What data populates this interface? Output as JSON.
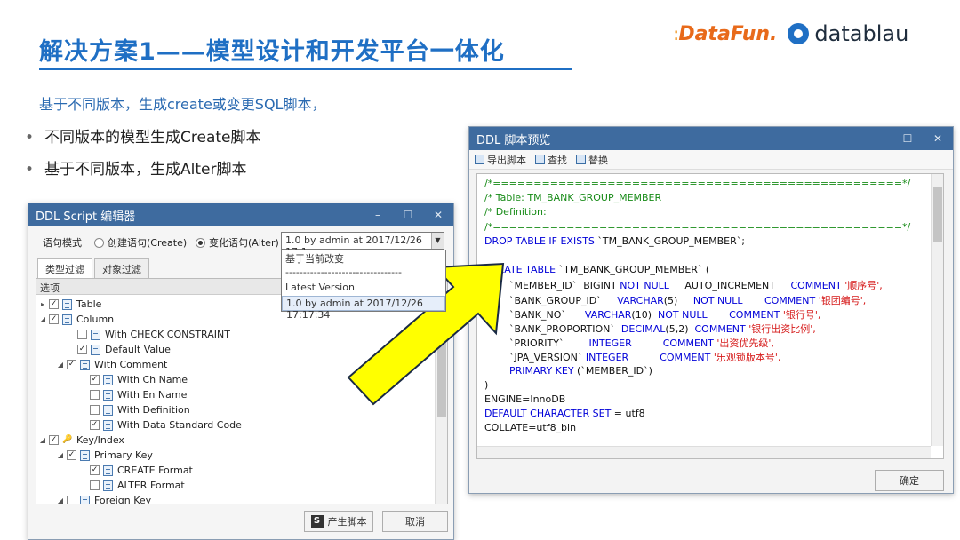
{
  "slide": {
    "title": "解决方案1——模型设计和开发平台一体化",
    "subtitle": "基于不同版本，生成create或变更SQL脚本，",
    "bullets": [
      "不同版本的模型生成Create脚本",
      "基于不同版本，生成Alter脚本"
    ],
    "logo_left": "DataFun.",
    "logo_right": "datablau"
  },
  "editor": {
    "title": "DDL Script 编辑器",
    "controls": [
      "–",
      "☐",
      "✕"
    ],
    "mode_label": "语句模式",
    "radio_create": "创建语句(Create)",
    "radio_alter": "变化语句(Alter)",
    "select_value": "1.0 by admin at 2017/12/26 17:1...",
    "dropdown_options": [
      "基于当前改变",
      "---------------------------------",
      "Latest Version",
      "1.0 by admin at 2017/12/26 17:17:34"
    ],
    "tabs": [
      "类型过滤",
      "对象过滤"
    ],
    "tree_header": "选项",
    "tree": [
      {
        "label": "Table",
        "checked": "☑",
        "exp": "▸"
      },
      {
        "label": "Column",
        "checked": "☑",
        "exp": "◢"
      },
      {
        "label": "With CHECK CONSTRAINT",
        "checked": "",
        "exp": ""
      },
      {
        "label": "Default Value",
        "checked": "✓",
        "exp": ""
      },
      {
        "label": "With Comment",
        "checked": "✓",
        "exp": "◢"
      },
      {
        "label": "With Ch Name",
        "checked": "✓",
        "exp": ""
      },
      {
        "label": "With En Name",
        "checked": "",
        "exp": ""
      },
      {
        "label": "With Definition",
        "checked": "",
        "exp": ""
      },
      {
        "label": "With Data Standard Code",
        "checked": "✓",
        "exp": ""
      },
      {
        "label": "Key/Index",
        "checked": "✓",
        "exp": "◢"
      },
      {
        "label": "Primary Key",
        "checked": "✓",
        "exp": "◢"
      },
      {
        "label": "CREATE Format",
        "checked": "✓",
        "exp": ""
      },
      {
        "label": "ALTER Format",
        "checked": "",
        "exp": ""
      },
      {
        "label": "Foreign Key",
        "checked": "",
        "exp": "◢"
      }
    ],
    "generate_label": "产生脚本",
    "cancel_label": "取消"
  },
  "preview": {
    "title": "DDL 脚本预览",
    "controls": [
      "–",
      "☐",
      "✕"
    ],
    "toolbar": [
      "导出脚本",
      "查找",
      "替换"
    ],
    "code": [
      {
        "parts": [
          {
            "t": "/*==================================================*/",
            "c": "green"
          }
        ]
      },
      {
        "parts": [
          {
            "t": "/* Table: TM_BANK_GROUP_MEMBER",
            "c": "green"
          }
        ]
      },
      {
        "parts": [
          {
            "t": "/* Definition:",
            "c": "green"
          }
        ]
      },
      {
        "parts": [
          {
            "t": "/*==================================================*/",
            "c": "green"
          }
        ]
      },
      {
        "parts": [
          {
            "t": "DROP TABLE IF EXISTS ",
            "c": "blue"
          },
          {
            "t": "`TM_BANK_GROUP_MEMBER`;",
            "c": "black"
          }
        ]
      },
      {
        "parts": [
          {
            "t": "",
            "c": "black"
          }
        ]
      },
      {
        "parts": [
          {
            "t": "CREATE TABLE ",
            "c": "blue"
          },
          {
            "t": "`TM_BANK_GROUP_MEMBER` (",
            "c": "black"
          }
        ]
      },
      {
        "parts": [
          {
            "t": "        `MEMBER_ID`  BIGINT ",
            "c": "black"
          },
          {
            "t": "NOT NULL",
            "c": "blue"
          },
          {
            "t": "     AUTO_INCREMENT     ",
            "c": "black"
          },
          {
            "t": "COMMENT ",
            "c": "blue"
          },
          {
            "t": "'顺序号',",
            "c": "red"
          }
        ]
      },
      {
        "parts": [
          {
            "t": "        `BANK_GROUP_ID`     ",
            "c": "black"
          },
          {
            "t": "VARCHAR",
            "c": "blue"
          },
          {
            "t": "(5)     ",
            "c": "black"
          },
          {
            "t": "NOT NULL",
            "c": "blue"
          },
          {
            "t": "       ",
            "c": "black"
          },
          {
            "t": "COMMENT ",
            "c": "blue"
          },
          {
            "t": "'银团编号',",
            "c": "red"
          }
        ]
      },
      {
        "parts": [
          {
            "t": "        `BANK_NO`      ",
            "c": "black"
          },
          {
            "t": "VARCHAR",
            "c": "blue"
          },
          {
            "t": "(10)  ",
            "c": "black"
          },
          {
            "t": "NOT NULL",
            "c": "blue"
          },
          {
            "t": "       ",
            "c": "black"
          },
          {
            "t": "COMMENT ",
            "c": "blue"
          },
          {
            "t": "'银行号',",
            "c": "red"
          }
        ]
      },
      {
        "parts": [
          {
            "t": "        `BANK_PROPORTION`  ",
            "c": "black"
          },
          {
            "t": "DECIMAL",
            "c": "blue"
          },
          {
            "t": "(5,2)  ",
            "c": "black"
          },
          {
            "t": "COMMENT ",
            "c": "blue"
          },
          {
            "t": "'银行出资比例',",
            "c": "red"
          }
        ]
      },
      {
        "parts": [
          {
            "t": "        `PRIORITY`        ",
            "c": "black"
          },
          {
            "t": "INTEGER",
            "c": "blue"
          },
          {
            "t": "          ",
            "c": "black"
          },
          {
            "t": "COMMENT ",
            "c": "blue"
          },
          {
            "t": "'出资优先级',",
            "c": "red"
          }
        ]
      },
      {
        "parts": [
          {
            "t": "        `JPA_VERSION` ",
            "c": "black"
          },
          {
            "t": "INTEGER",
            "c": "blue"
          },
          {
            "t": "          ",
            "c": "black"
          },
          {
            "t": "COMMENT ",
            "c": "blue"
          },
          {
            "t": "'乐观锁版本号',",
            "c": "red"
          }
        ]
      },
      {
        "parts": [
          {
            "t": "        PRIMARY KEY ",
            "c": "blue"
          },
          {
            "t": "(`MEMBER_ID`)",
            "c": "black"
          }
        ]
      },
      {
        "parts": [
          {
            "t": ")",
            "c": "black"
          }
        ]
      },
      {
        "parts": [
          {
            "t": "ENGINE=InnoDB",
            "c": "black"
          }
        ]
      },
      {
        "parts": [
          {
            "t": "DEFAULT CHARACTER SET ",
            "c": "blue"
          },
          {
            "t": "= utf8",
            "c": "black"
          }
        ]
      },
      {
        "parts": [
          {
            "t": "COLLATE=utf8_bin",
            "c": "black"
          }
        ]
      }
    ],
    "confirm_label": "确定"
  },
  "colors": {
    "accent": "#1f6fc4",
    "titlebar": "#3e6b9f",
    "arrow_fill": "#ffff00"
  }
}
